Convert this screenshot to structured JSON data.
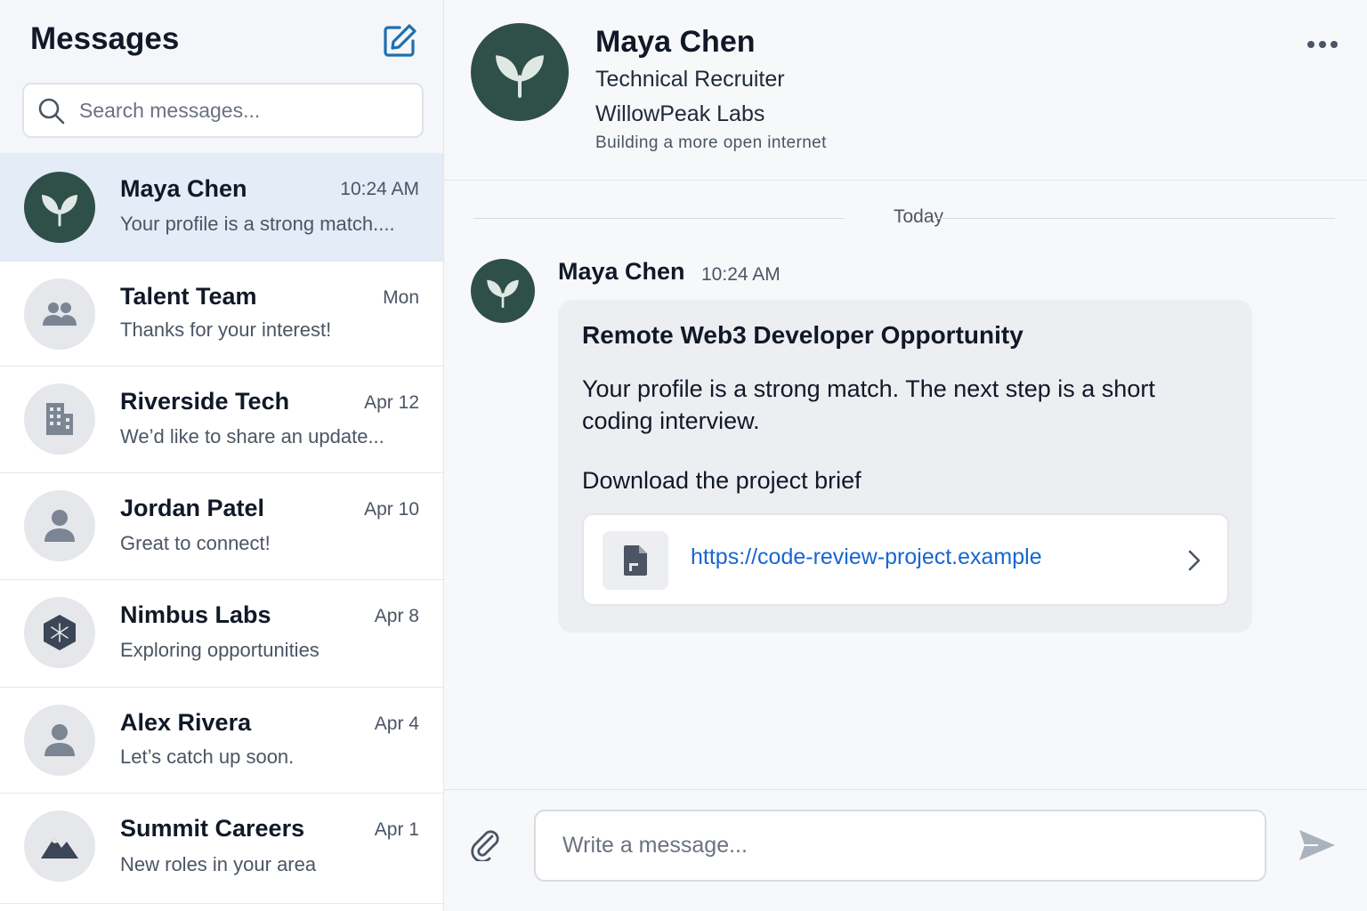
{
  "sidebar": {
    "title": "Messages",
    "search_placeholder": "Search messages...",
    "conversations": [
      {
        "name": "Maya Chen",
        "time": "10:24 AM",
        "preview": "Your profile is a strong match....",
        "avatar": "sprout-icon",
        "active": true
      },
      {
        "name": "Talent Team",
        "time": "Mon",
        "preview": "Thanks for your interest!",
        "avatar": "people-icon"
      },
      {
        "name": "Riverside Tech",
        "time": "Apr 12",
        "preview": "We’d like to share an update...",
        "avatar": "building-icon"
      },
      {
        "name": "Jordan Patel",
        "time": "Apr 10",
        "preview": "Great to connect!",
        "avatar": "person-icon"
      },
      {
        "name": "Nimbus Labs",
        "time": "Apr 8",
        "preview": "Exploring opportunities",
        "avatar": "hexagon-icon"
      },
      {
        "name": "Alex Rivera",
        "time": "Apr 4",
        "preview": "Let’s catch up soon.",
        "avatar": "person-icon"
      },
      {
        "name": "Summit Careers",
        "time": "Apr 1",
        "preview": "New roles in your area",
        "avatar": "mountain-icon"
      }
    ]
  },
  "header": {
    "name": "Maya Chen",
    "role": "Technical Recruiter",
    "company": "WillowPeak Labs",
    "tagline": "Building a more open internet"
  },
  "thread": {
    "day_label": "Today",
    "message": {
      "sender": "Maya Chen",
      "time": "10:24 AM",
      "title": "Remote Web3 Developer Opportunity",
      "body": "Your profile is a strong match. The next step is a short coding interview.",
      "download_label": "Download the project brief",
      "link_url": "https://code-review-project.example"
    }
  },
  "composer": {
    "placeholder": "Write a message..."
  },
  "colors": {
    "brand_green": "#2f4f49",
    "active_row": "#e4ecf8",
    "link": "#1766d1"
  }
}
